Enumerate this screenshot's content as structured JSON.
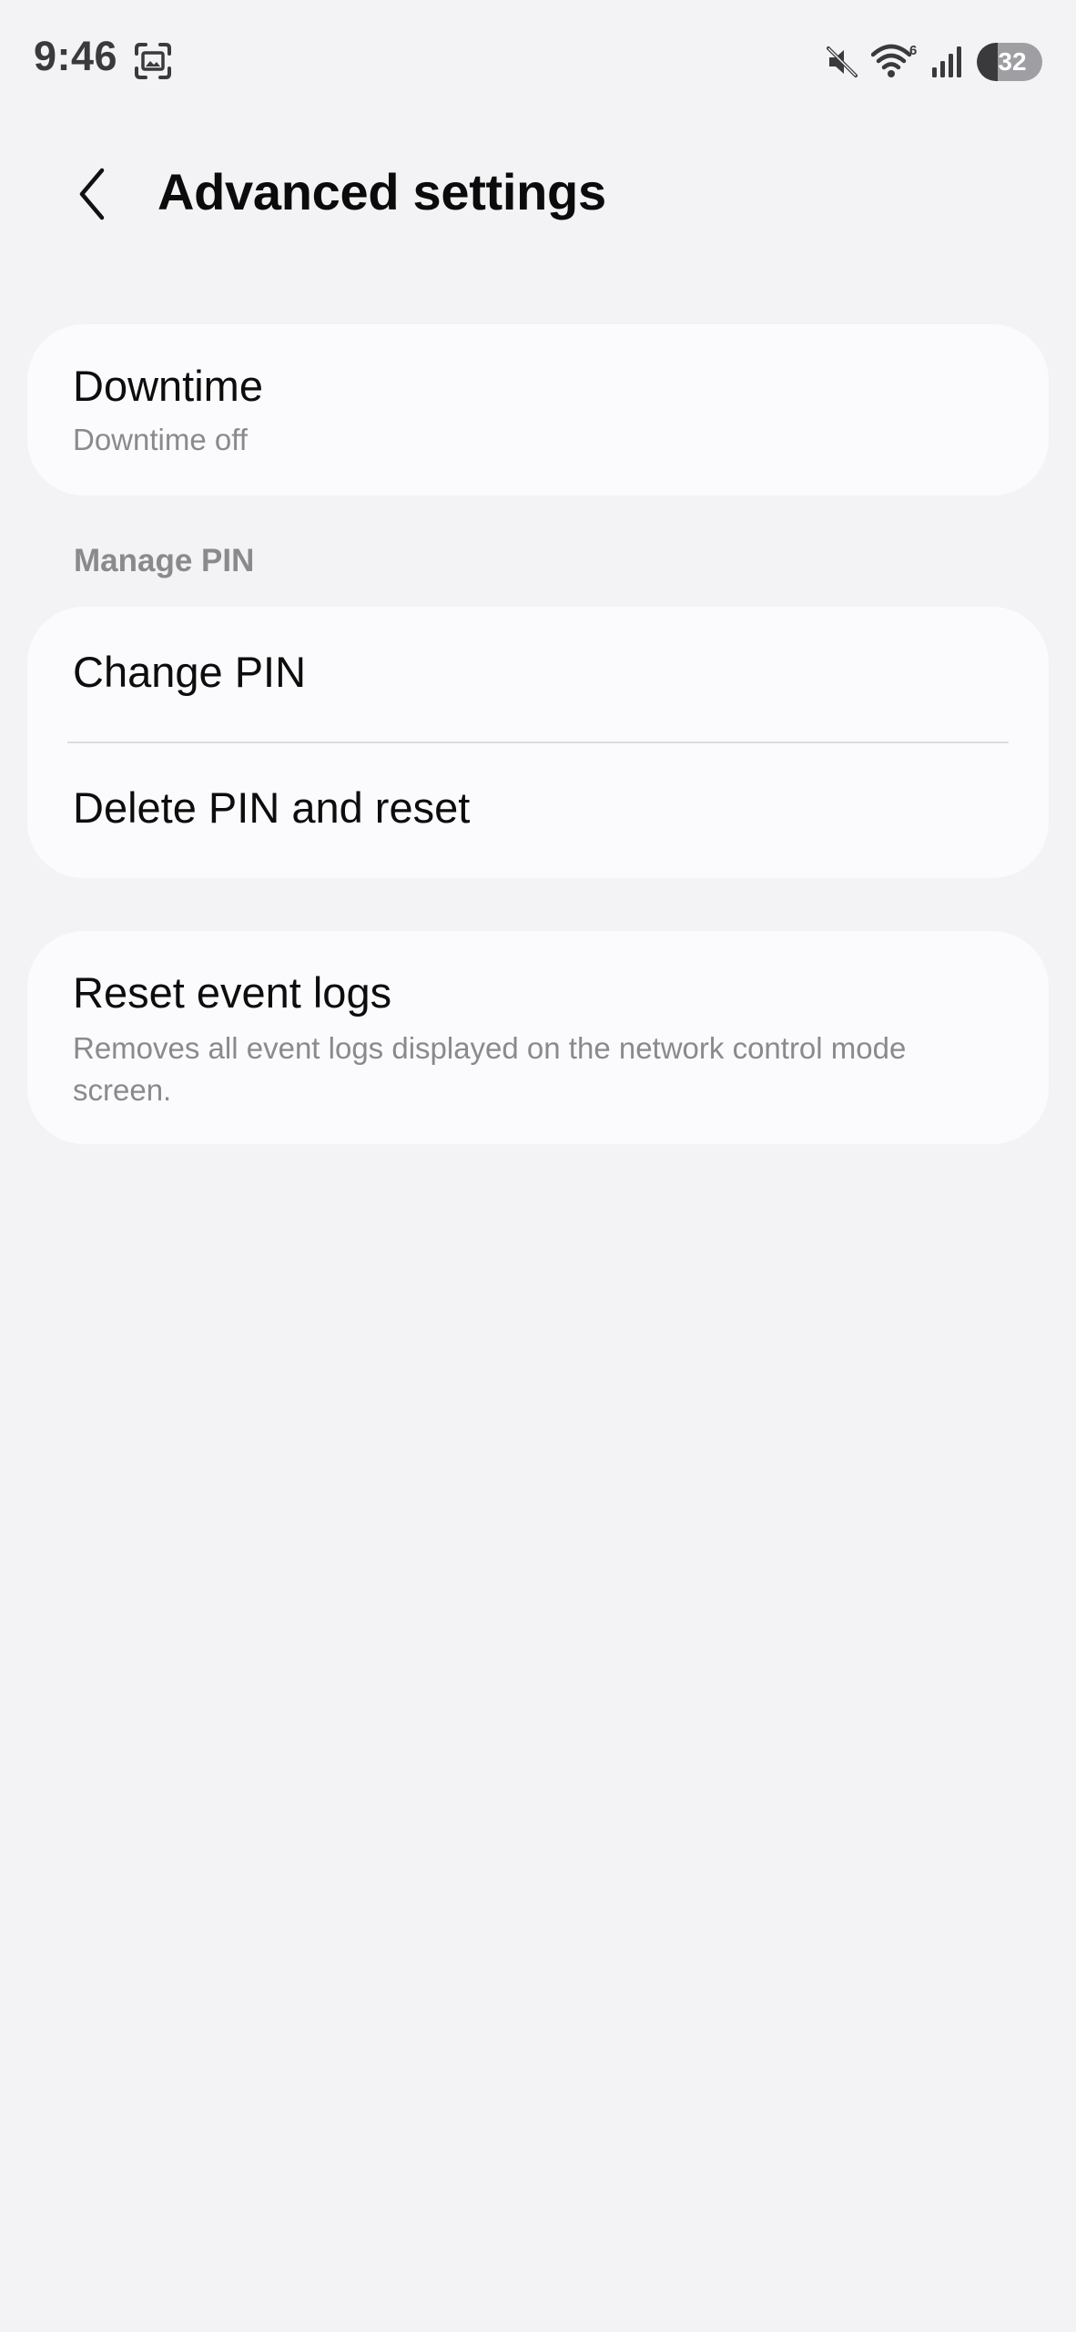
{
  "status_bar": {
    "time": "9:46",
    "screenshot_icon": "screenshot-icon",
    "mute_icon": "muted-speaker-icon",
    "wifi_icon": "wifi-6-icon",
    "wifi_badge": "6",
    "signal_icon": "cellular-signal-icon",
    "battery_level_percent": 32,
    "battery_text": "32"
  },
  "header": {
    "back_icon": "chevron-left-icon",
    "title": "Advanced settings"
  },
  "downtime": {
    "title": "Downtime",
    "subtitle": "Downtime off"
  },
  "manage_pin": {
    "section_label": "Manage PIN",
    "items": [
      {
        "label": "Change PIN"
      },
      {
        "label": "Delete PIN and reset"
      }
    ]
  },
  "reset_event_logs": {
    "title": "Reset event logs",
    "description": "Removes all event logs displayed on the network control mode screen."
  },
  "colors": {
    "background": "#f3f3f5",
    "card": "#fbfbfd",
    "primary_text": "#0d0d0e",
    "secondary_text": "#8a8a8e"
  }
}
